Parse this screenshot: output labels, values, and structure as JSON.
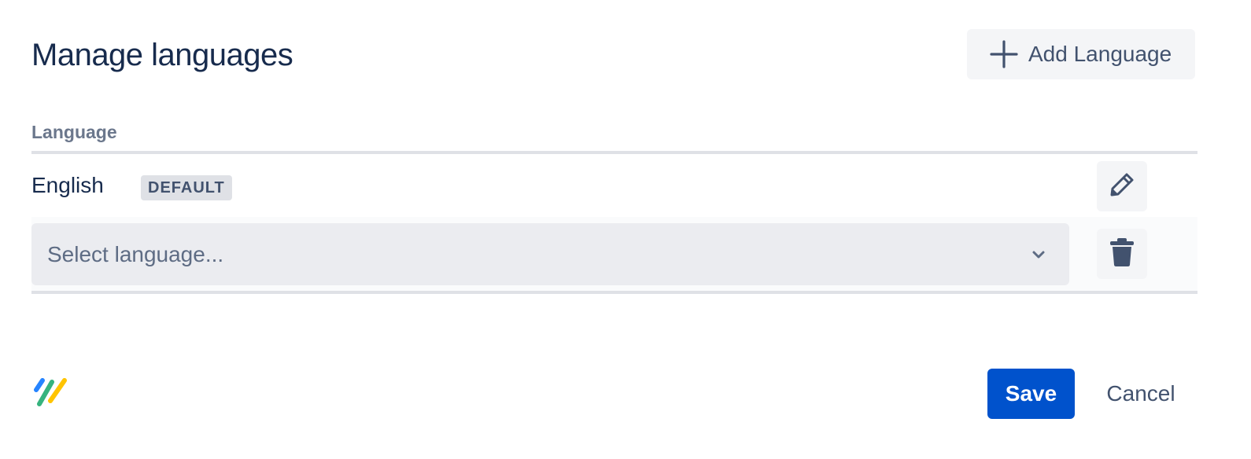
{
  "header": {
    "title": "Manage languages",
    "add_button_label": "Add Language"
  },
  "table": {
    "column_header": "Language",
    "rows": [
      {
        "language": "English",
        "badge": "DEFAULT",
        "action_icon": "pencil-icon"
      },
      {
        "select_placeholder": "Select language...",
        "action_icon": "trash-icon"
      }
    ]
  },
  "footer": {
    "save_label": "Save",
    "cancel_label": "Cancel"
  },
  "colors": {
    "primary": "#0052cc",
    "title_text": "#172b4d",
    "secondary_text": "#42526e",
    "button_bg": "#f4f5f7",
    "select_bg": "#ebecf0",
    "divider": "#dfe1e6"
  }
}
